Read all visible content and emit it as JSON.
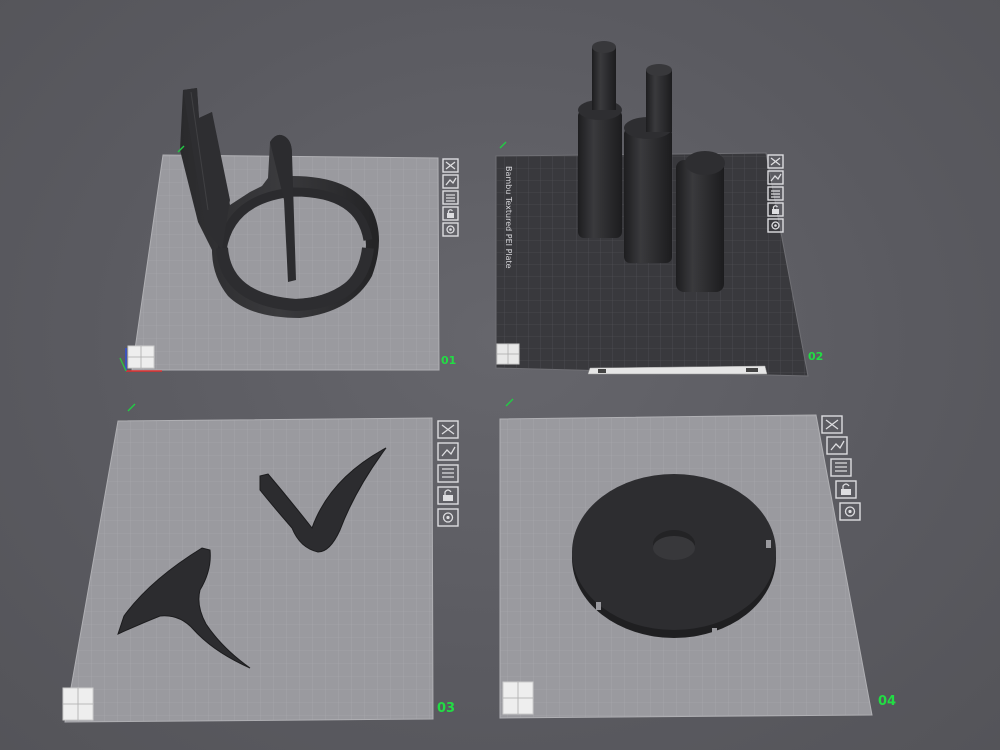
{
  "app": {
    "view": "3D prepare view",
    "accent_color": "#22dd44"
  },
  "plates": [
    {
      "number": "01",
      "type": "default-plate",
      "objects": "filament holder arm and ring",
      "tools": [
        "close-icon",
        "arrange-icon",
        "orient-icon",
        "lock-icon",
        "settings-icon"
      ]
    },
    {
      "number": "02",
      "type": "textured-plate",
      "plate_name": "Bambu Textured PEI Plate",
      "objects": "three stepped cylindrical pegs",
      "tools": [
        "close-icon",
        "arrange-icon",
        "orient-icon",
        "lock-icon",
        "settings-icon"
      ]
    },
    {
      "number": "03",
      "type": "default-plate",
      "objects": "two curved bracket pieces",
      "tools": [
        "close-icon",
        "arrange-icon",
        "orient-icon",
        "lock-icon",
        "settings-icon"
      ]
    },
    {
      "number": "04",
      "type": "default-plate",
      "objects": "round notched disc",
      "tools": [
        "close-icon",
        "arrange-icon",
        "orient-icon",
        "lock-icon",
        "settings-icon"
      ]
    }
  ]
}
